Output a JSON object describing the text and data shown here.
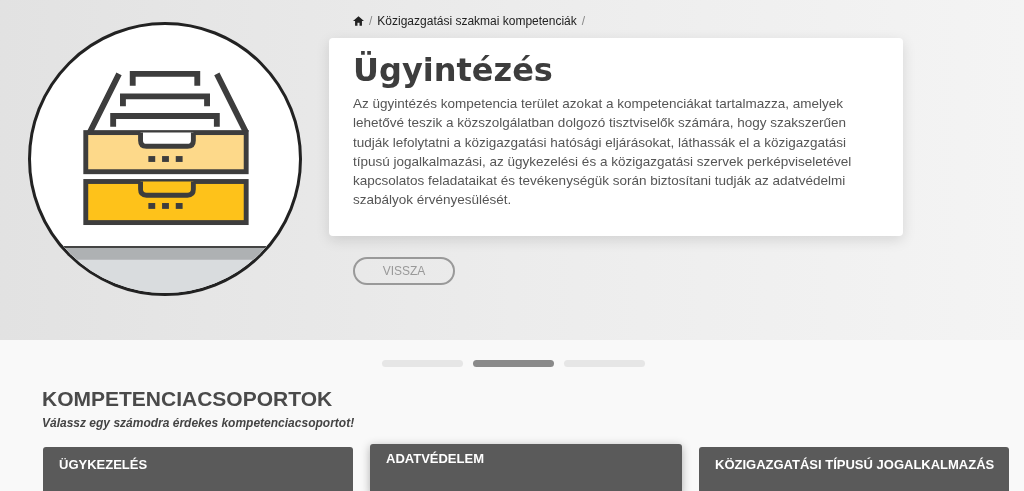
{
  "breadcrumb": {
    "items": [
      "Közigazgatási szakmai kompetenciák"
    ],
    "separator": "/"
  },
  "hero": {
    "title": "Ügyintézés",
    "description": "Az ügyintézés kompetencia terület azokat a kompetenciákat tartalmazza, amelyek lehetővé teszik a közszolgálatban dolgozó tisztviselők számára, hogy szakszerűen tudják lefolytatni a közigazgatási hatósági eljárásokat, láthassák el a közigazgatási típusú jogalkalmazási, az ügykezelési és a közigazgatási szervek perképviseletével kapcsolatos feladataikat és tevékenységük során biztosítani tudják az adatvédelmi szabályok érvényesülését.",
    "back_button": "VISSZA"
  },
  "slider_dots": [
    {
      "selected": false
    },
    {
      "selected": true
    },
    {
      "selected": false
    }
  ],
  "section": {
    "title": "KOMPETENCIACSOPORTOK",
    "subtitle": "Válassz egy számodra érdekes kompetenciacsoportot!"
  },
  "groups": [
    {
      "title": "ÜGYKEZELÉS",
      "selected": false
    },
    {
      "title": "ADATVÉDELEM",
      "selected": true
    },
    {
      "title": "KÖZIGAZGATÁSI TÍPUSÚ JOGALKALMAZÁS",
      "selected": false
    }
  ]
}
